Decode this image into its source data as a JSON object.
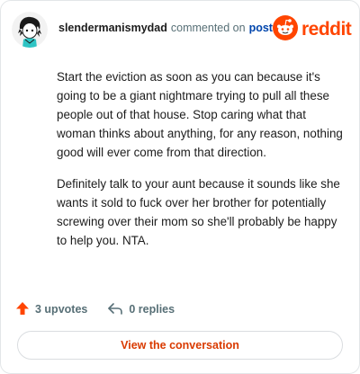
{
  "comment": {
    "username": "slendermanismydad",
    "commented_text": "commented on",
    "post_link": "post",
    "paragraphs": [
      "Start the eviction as soon as you can because it's going to be a giant nightmare trying to pull all these people out of that house. Stop caring what that woman thinks about anything, for any reason, nothing good will ever come from that direction.",
      "Definitely talk to your aunt because it sounds like she wants it sold to fuck over her brother for potentially screwing over their mom so she'll probably be happy to help you. NTA."
    ]
  },
  "brand": {
    "word": "reddit",
    "color": "#ff4500"
  },
  "actions": {
    "upvotes": "3 upvotes",
    "replies": "0 replies"
  },
  "view_conversation": "View the conversation",
  "icons": {
    "avatar": "avatar",
    "logo": "reddit-snoo-icon",
    "upvote": "upvote-arrow-icon",
    "reply": "reply-arrow-icon"
  }
}
